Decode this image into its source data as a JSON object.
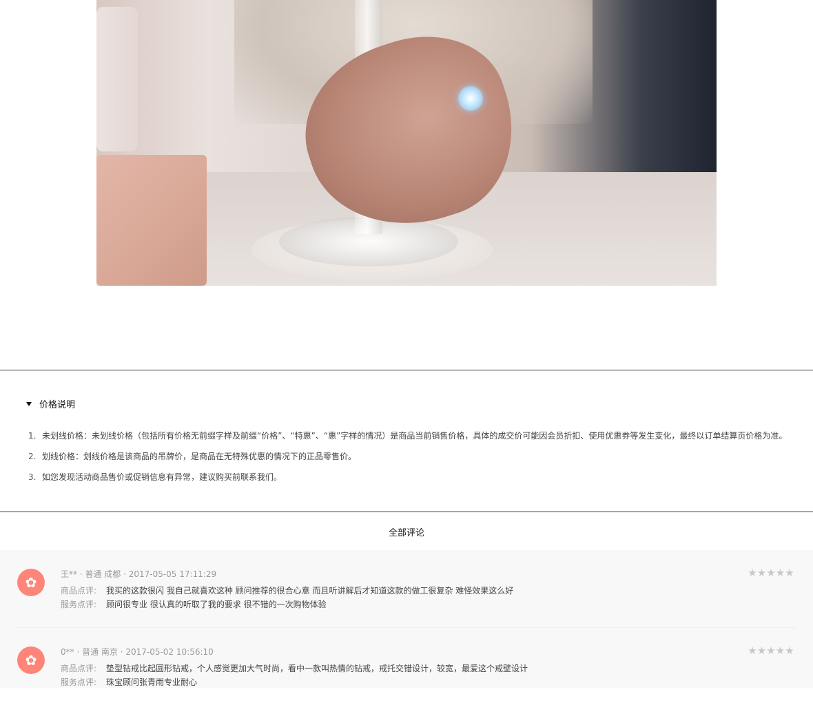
{
  "hero": {
    "alt": "ring-on-hand-photo"
  },
  "price_info": {
    "title": "价格说明",
    "items": [
      {
        "num": "1.",
        "term": "未划线价格：",
        "text": "未划线价格（包括所有价格无前缀字样及前缀“价格”、“特惠”、“惠”字样的情况）是商品当前销售价格，具体的成交价可能因会员折扣、使用优惠券等发生变化，最终以订单结算页价格为准。"
      },
      {
        "num": "2.",
        "term": "划线价格：",
        "text": "划线价格是该商品的吊牌价，是商品在无特殊优惠的情况下的正品零售价。"
      },
      {
        "num": "3.",
        "term": "",
        "text": "如您发现活动商品售价或促销信息有异常，建议购买前联系我们。"
      }
    ]
  },
  "reviews": {
    "title": "全部评论",
    "product_label": "商品点评:",
    "service_label": "服务点评:",
    "items": [
      {
        "meta": "王** · 普通 成都 · 2017-05-05 17:11:29",
        "rating": 5,
        "product": "我买的这款很闪 我自己就喜欢这种 顾问推荐的很合心意 而且听讲解后才知道这款的做工很复杂 难怪效果这么好",
        "service": "顾问很专业 很认真的听取了我的要求 很不错的一次购物体验"
      },
      {
        "meta": "0** · 普通 南京 · 2017-05-02 10:56:10",
        "rating": 5,
        "product": "垫型钻戒比起圆形钻戒，个人感觉更加大气时尚，看中一款叫热情的钻戒，戒托交错设计，较宽，最爱这个戒壁设计",
        "service": "珠宝顾问张青雨专业耐心"
      }
    ]
  },
  "icons": {
    "avatar": "rose-icon",
    "star": "star-icon",
    "toggle": "caret-down-icon"
  },
  "colors": {
    "avatar_bg": "#ff8579",
    "star": "#c8c8c8",
    "reviews_bg": "#f8f8f8"
  }
}
